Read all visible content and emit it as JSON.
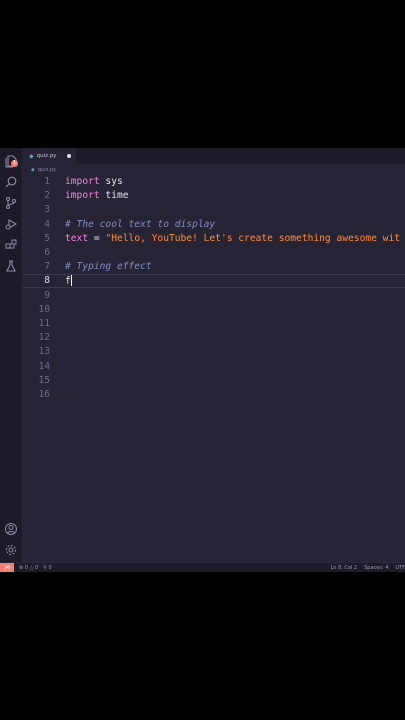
{
  "tab": {
    "filename": "quiz.py",
    "icon": "python-file-icon"
  },
  "breadcrumb": {
    "filename": "quiz.py"
  },
  "activity_bar": {
    "badge_count": "1",
    "icons": [
      "files-icon",
      "search-icon",
      "source-control-icon",
      "run-debug-icon",
      "extensions-icon",
      "testing-icon",
      "account-icon",
      "settings-gear-icon"
    ]
  },
  "editor": {
    "current_line": 8,
    "lines": [
      {
        "num": "1",
        "kw": "import",
        "rest": " sys"
      },
      {
        "num": "2",
        "kw": "import",
        "rest": " time"
      },
      {
        "num": "3"
      },
      {
        "num": "4",
        "comment": "# The cool text to display"
      },
      {
        "num": "5",
        "var": "text",
        "op": " = ",
        "str": "\"Hello, YouTube! Let's create something awesome wit"
      },
      {
        "num": "6"
      },
      {
        "num": "7",
        "comment": "# Typing effect"
      },
      {
        "num": "8",
        "typed": "f"
      },
      {
        "num": "9"
      },
      {
        "num": "10"
      },
      {
        "num": "11"
      },
      {
        "num": "12"
      },
      {
        "num": "13"
      },
      {
        "num": "14"
      },
      {
        "num": "15"
      },
      {
        "num": "16"
      }
    ]
  },
  "status_bar": {
    "errors": "0",
    "warnings": "0",
    "ports": "0",
    "position": "Ln 8, Col 2",
    "spaces": "Spaces: 4",
    "encoding": "UTF"
  },
  "colors": {
    "accent": "#f97e72",
    "background": "#262335",
    "sidebar": "#1e1b29"
  }
}
